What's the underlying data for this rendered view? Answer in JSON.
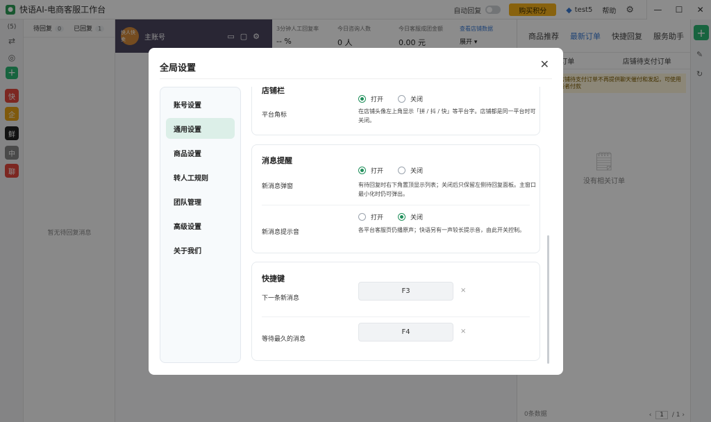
{
  "app": {
    "title": "快语AI-电商客服工作台",
    "auto_reply_label": "自动回复",
    "buy_points_label": "购买积分",
    "user_name": "test5",
    "help_label": "帮助",
    "window_controls": [
      "—",
      "☐",
      "✕"
    ]
  },
  "rail": {
    "count": "(5)",
    "shops": [
      {
        "label": "快",
        "color": "#e2483d"
      },
      {
        "label": "企",
        "color": "#e8a317"
      },
      {
        "label": "鲜",
        "color": "#222222"
      },
      {
        "label": "中",
        "color": "#888888"
      },
      {
        "label": "聊",
        "color": "#e2483d"
      }
    ]
  },
  "conversations": {
    "tabs": [
      {
        "label": "待回复",
        "count": "0"
      },
      {
        "label": "已回复",
        "count": "1"
      }
    ],
    "empty_text": "暂无待回复消息"
  },
  "chat_header": {
    "avatar_text": "快人快卖",
    "account_label": "主账号"
  },
  "stats": [
    {
      "label": "3分钟人工回复率",
      "value": "-- %"
    },
    {
      "label": "今日咨询人数",
      "value": "0 人"
    },
    {
      "label": "今日客服成团金额",
      "value": "0.00 元"
    },
    {
      "label": "查看店铺数据",
      "value": "展开 ▾"
    }
  ],
  "right_panel": {
    "tabs": [
      "商品推荐",
      "最新订单",
      "快捷回复",
      "服务助手"
    ],
    "active_tab": "最新订单",
    "sub_tabs": [
      "最新订单",
      "店铺待支付订单"
    ],
    "notice": "当前为体验，店铺待支付订单不再提供聊天催付和发起，可使用催支付促进消费者付款",
    "empty_text": "没有相关订单",
    "footer_count": "0条数据",
    "page": "1",
    "page_total": "/ 1"
  },
  "modal": {
    "title": "全局设置",
    "close_label": "✕",
    "nav": [
      {
        "label": "账号设置",
        "active": false
      },
      {
        "label": "通用设置",
        "active": true
      },
      {
        "label": "商品设置",
        "active": false
      },
      {
        "label": "转人工规则",
        "active": false
      },
      {
        "label": "团队管理",
        "active": false
      },
      {
        "label": "高级设置",
        "active": false
      },
      {
        "label": "关于我们",
        "active": false
      }
    ],
    "shop_section": {
      "title": "店铺栏",
      "rows": [
        {
          "label": "平台角标",
          "option_on": "打开",
          "option_off": "关闭",
          "selected": "on",
          "desc": "在店铺头像左上角显示「拼 / 抖 / 快」等平台字。店铺都是同一平台时可关闭。"
        }
      ]
    },
    "message_section": {
      "title": "消息提醒",
      "rows": [
        {
          "label": "新消息弹窗",
          "option_on": "打开",
          "option_off": "关闭",
          "selected": "on",
          "desc": "有待回复时右下角置顶显示列表；关闭后只保留左侧待回复面板。主窗口最小化时仍可弹出。"
        },
        {
          "label": "新消息提示音",
          "option_on": "打开",
          "option_off": "关闭",
          "selected": "off",
          "desc": "各平台客服页仍播原声；快语另有一声较长提示音，由此开关控制。"
        }
      ]
    },
    "hotkey_section": {
      "title": "快捷键",
      "rows": [
        {
          "label": "下一条新消息",
          "key": "F3",
          "clear": "×"
        },
        {
          "label": "等待最久的消息",
          "key": "F4",
          "clear": "×"
        }
      ]
    }
  }
}
